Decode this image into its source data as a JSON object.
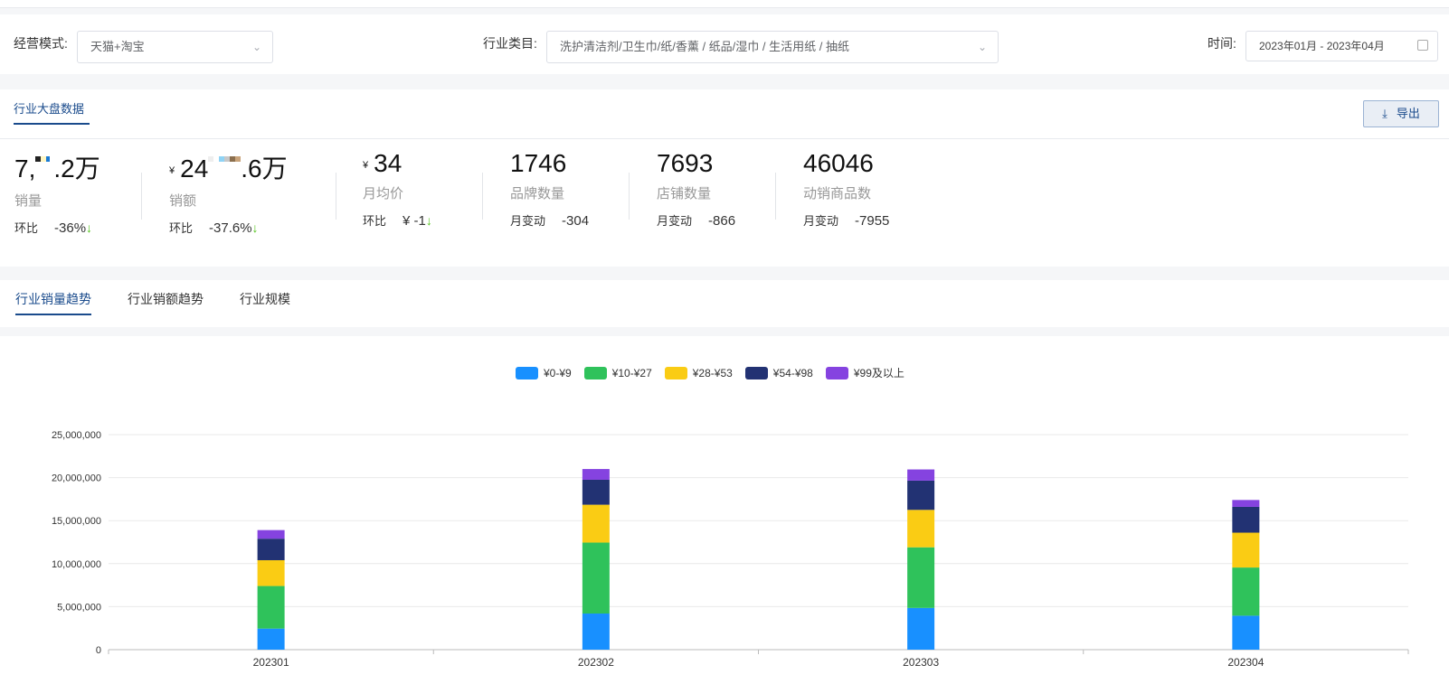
{
  "filters": {
    "mode_label": "经营模式:",
    "mode_value": "天猫+淘宝",
    "category_label": "行业类目:",
    "category_value": "洗护清洁剂/卫生巾/纸/香薰 / 纸品/湿巾 / 生活用纸 / 抽纸",
    "time_label": "时间:",
    "time_value": "2023年01月 - 2023年04月"
  },
  "overview": {
    "tab_label": "行业大盘数据",
    "export_label": "导出",
    "stats": [
      {
        "value_prefix": "7,",
        "value_suffix": ".2万",
        "label": "销量",
        "change_label": "环比",
        "change_value": "-36%",
        "arrow": "↓"
      },
      {
        "currency": "¥",
        "value_prefix": "24",
        "value_suffix": ".6万",
        "label": "销额",
        "change_label": "环比",
        "change_value": "-37.6%",
        "arrow": "↓"
      },
      {
        "currency": "¥",
        "value": "34",
        "label": "月均价",
        "change_label": "环比",
        "change_value": "¥ -1",
        "arrow": "↓"
      },
      {
        "value": "1746",
        "label": "品牌数量",
        "change_label": "月变动",
        "change_value": "-304"
      },
      {
        "value": "7693",
        "label": "店铺数量",
        "change_label": "月变动",
        "change_value": "-866"
      },
      {
        "value": "46046",
        "label": "动销商品数",
        "change_label": "月变动",
        "change_value": "-7955"
      }
    ]
  },
  "trend_tabs": [
    "行业销量趋势",
    "行业销额趋势",
    "行业规模"
  ],
  "colors": {
    "accent": "#1a4b8c",
    "down_green": "#52c41a",
    "series": [
      "#1890ff",
      "#2fc25b",
      "#facc14",
      "#223273",
      "#8543e0"
    ]
  },
  "chart_data": {
    "type": "bar",
    "stacked": true,
    "categories": [
      "202301",
      "202302",
      "202303",
      "202304"
    ],
    "series": [
      {
        "name": "¥0-¥9",
        "values": [
          2450000,
          4200000,
          4850000,
          3950000
        ]
      },
      {
        "name": "¥10-¥27",
        "values": [
          4950000,
          8250000,
          7050000,
          5600000
        ]
      },
      {
        "name": "¥28-¥53",
        "values": [
          3000000,
          4400000,
          4350000,
          4050000
        ]
      },
      {
        "name": "¥54-¥98",
        "values": [
          2500000,
          2900000,
          3400000,
          3000000
        ]
      },
      {
        "name": "¥99及以上",
        "values": [
          1000000,
          1250000,
          1300000,
          800000
        ]
      }
    ],
    "yticks": [
      "0",
      "5,000,000",
      "10,000,000",
      "15,000,000",
      "20,000,000",
      "25,000,000"
    ],
    "ylim": [
      0,
      25000000
    ],
    "grid": true,
    "legend": "top-center"
  }
}
